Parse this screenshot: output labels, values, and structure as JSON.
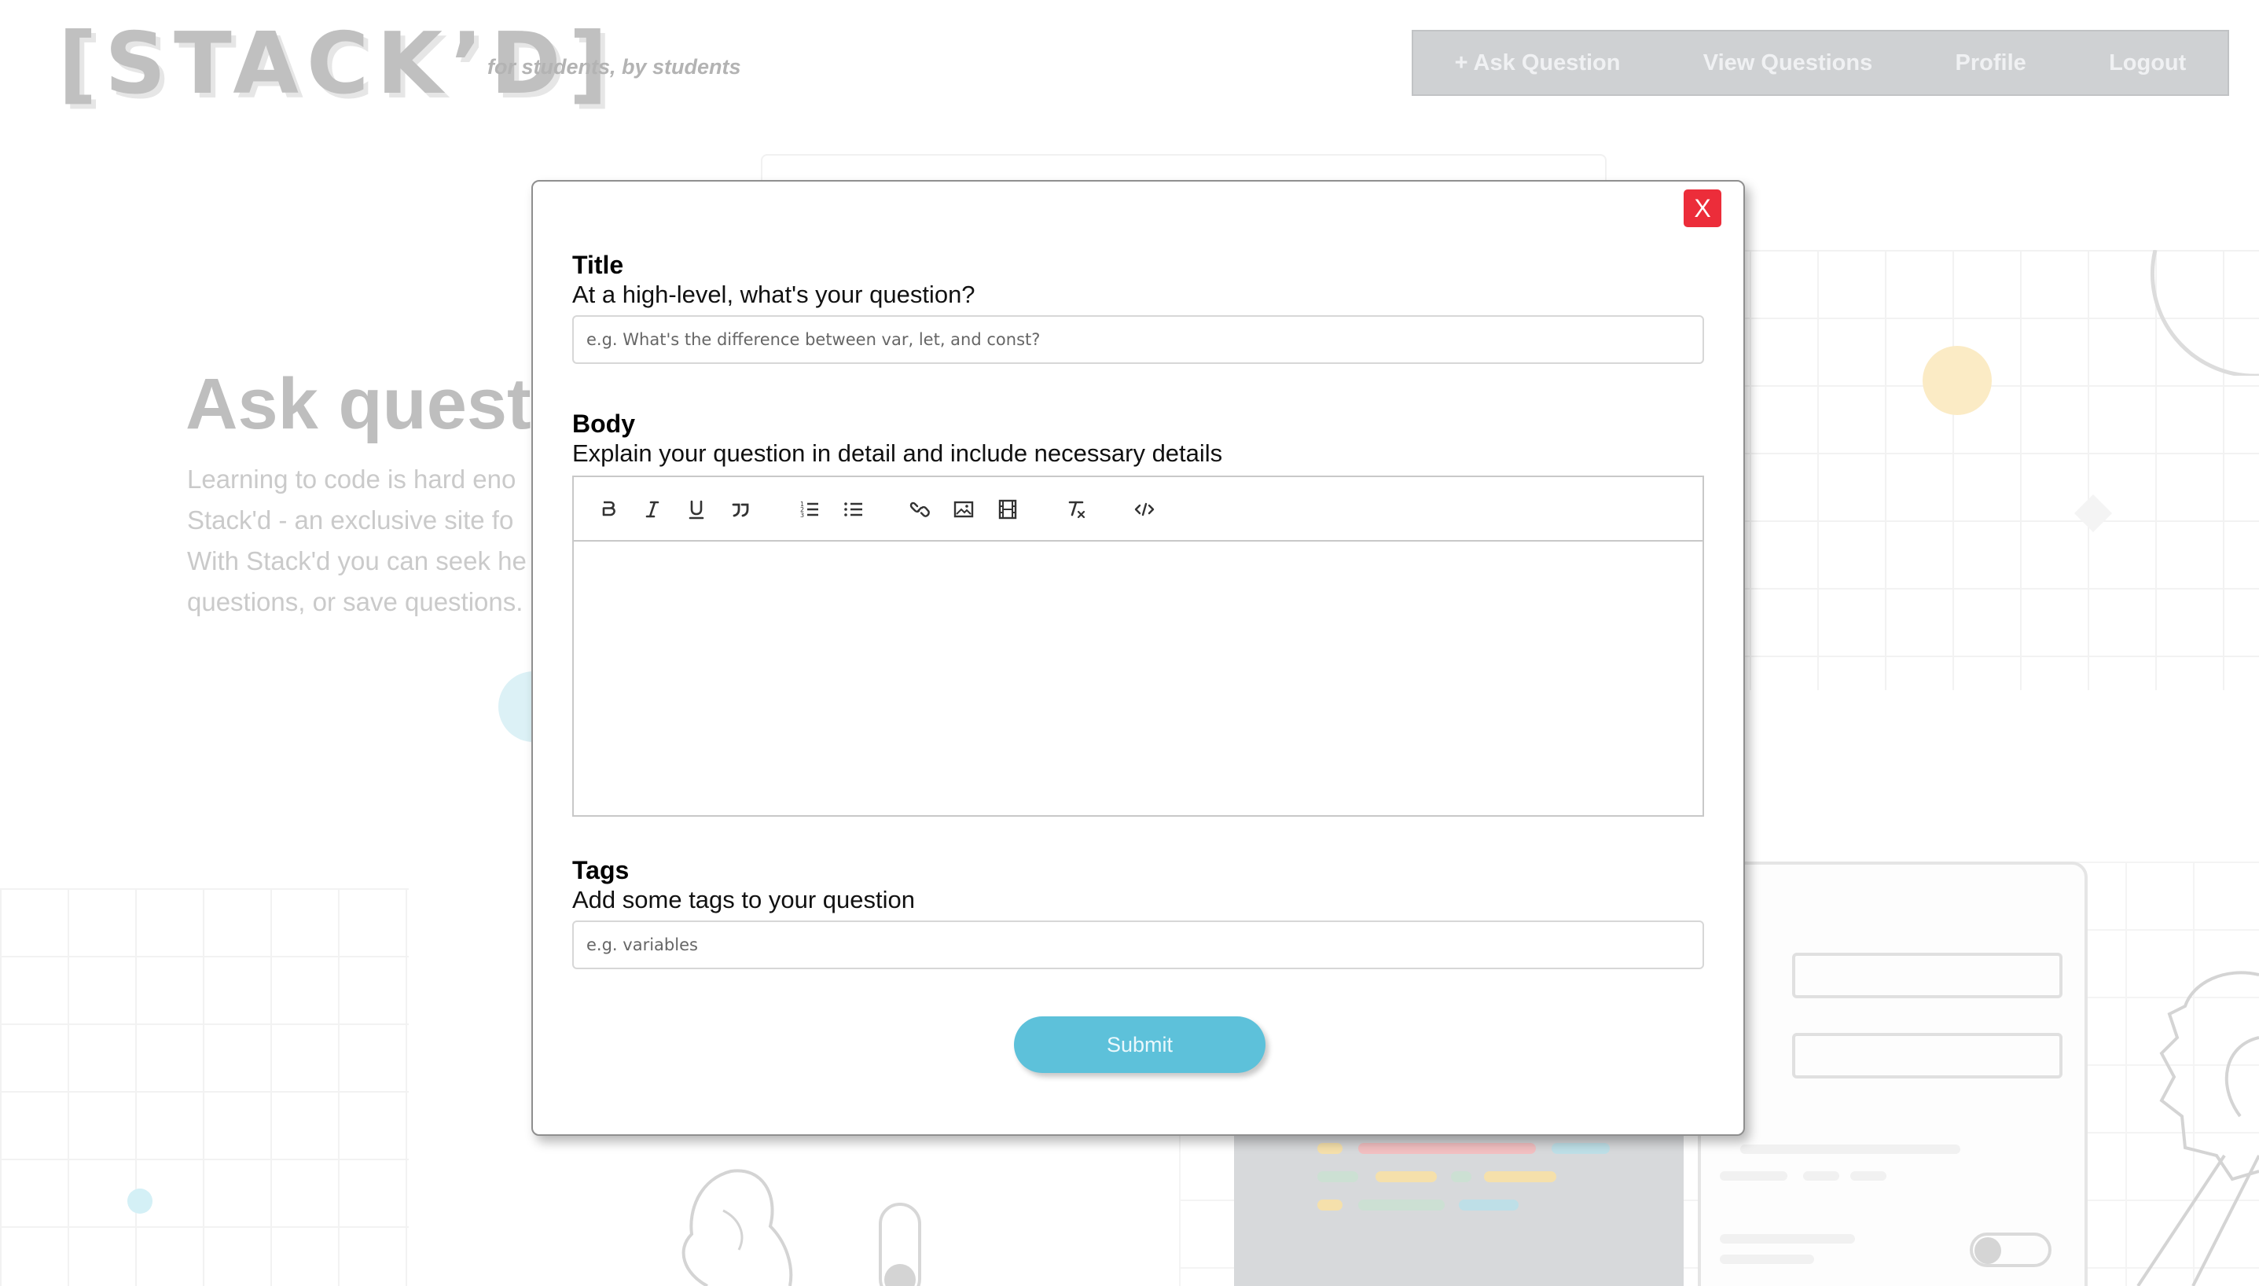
{
  "brand": {
    "logo": "[STACK’D]",
    "tagline": "for students, by students"
  },
  "nav": {
    "items": [
      "+ Ask Question",
      "View Questions",
      "Profile",
      "Logout"
    ]
  },
  "hero": {
    "title": "Ask questi",
    "lines": [
      "Learning to code is hard eno",
      "Stack'd - an exclusive site fo",
      "With Stack'd you can seek he",
      "questions, or save questions."
    ]
  },
  "modal": {
    "close_label": "X",
    "title_heading": "Title",
    "title_sub": "At a high-level, what's your question?",
    "title_placeholder": "e.g. What's the difference between var, let, and const?",
    "title_value": "",
    "body_heading": "Body",
    "body_sub": "Explain your question in detail and include necessary details",
    "body_value": "",
    "toolbar": [
      "bold-icon",
      "italic-icon",
      "underline-icon",
      "blockquote-icon",
      "ordered-list-icon",
      "bullet-list-icon",
      "link-icon",
      "image-icon",
      "video-icon",
      "clear-format-icon",
      "code-icon"
    ],
    "tags_heading": "Tags",
    "tags_sub": "Add some tags to your question",
    "tags_placeholder": "e.g. variables",
    "tags_value": "",
    "submit_label": "Submit"
  },
  "colors": {
    "close": "#ec2d3a",
    "submit": "#5dc1da",
    "nav_bg": "#c9cbcd"
  }
}
